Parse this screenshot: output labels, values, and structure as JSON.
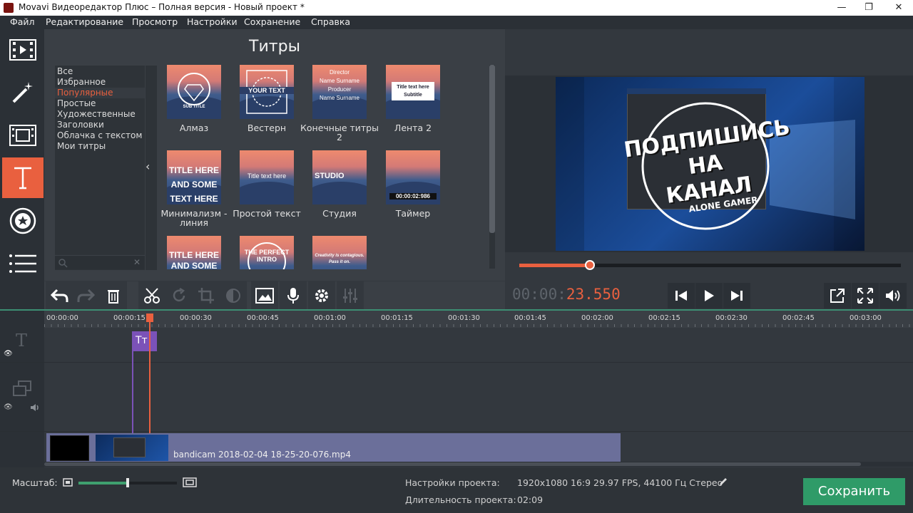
{
  "window": {
    "title": "Movavi Видеоредактор Плюс – Полная версия - Новый проект *",
    "minimize": "—",
    "maximize": "❐",
    "close": "✕"
  },
  "menu": [
    "Файл",
    "Редактирование",
    "Просмотр",
    "Настройки",
    "Сохранение",
    "Справка"
  ],
  "nav": [
    "film-import-icon",
    "magic-wand-icon",
    "filters-icon",
    "titles-icon",
    "stickers-icon",
    "menu-icon"
  ],
  "titles_panel": {
    "heading": "Титры",
    "categories": [
      "Все",
      "Избранное",
      "Популярные",
      "Простые",
      "Художественные",
      "Заголовки",
      "Облачка с текстом",
      "Мои титры"
    ],
    "selected_category": "Популярные",
    "tiles": [
      {
        "label": "Алмаз",
        "text": "SUB TITLE"
      },
      {
        "label": "Вестерн",
        "text": "YOUR TEXT"
      },
      {
        "label": "Конечные титры 2",
        "text": "Director\nName Surname\nProducer\nName Surname"
      },
      {
        "label": "Лента 2",
        "text": "Title text here\nSubtitle"
      },
      {
        "label": "Минимализм - линия",
        "text": "TITLE HERE\nAND SOME TEXT HERE"
      },
      {
        "label": "Простой текст",
        "text": "Title text here"
      },
      {
        "label": "Студия",
        "text": "STUDIO"
      },
      {
        "label": "Таймер",
        "text": "00:00:02:986"
      },
      {
        "label": "",
        "text": "TITLE HERE\nAND SOME TEXT HERE"
      },
      {
        "label": "",
        "text": "THE PERFECT INTRO"
      },
      {
        "label": "",
        "text": "Creativity is contagious.\nPass it on."
      }
    ]
  },
  "preview": {
    "overlay_line1": "ПОДПИШИСЬ",
    "overlay_line2": "НА",
    "overlay_line3": "КАНАЛ",
    "overlay_sub": "ALONE GAMER",
    "progress": 0.185
  },
  "timecode": {
    "dim": "00:00:",
    "hot": "23.550"
  },
  "ruler": [
    "00:00:00",
    "00:00:15",
    "00:00:30",
    "00:00:45",
    "00:01:00",
    "00:01:15",
    "00:01:30",
    "00:01:45",
    "00:02:00",
    "00:02:15",
    "00:02:30",
    "00:02:45",
    "00:03:00"
  ],
  "timeline": {
    "title_clip": "Тт",
    "video_clip_name": "bandicam 2018-02-04 18-25-20-076.mp4"
  },
  "bottom": {
    "scale_label": "Масштаб:",
    "settings_label": "Настройки проекта:",
    "settings_value": "1920x1080 16:9 29.97 FPS, 44100 Гц Стерео",
    "duration_label": "Длительность проекта:",
    "duration_value": "02:09",
    "save": "Сохранить",
    "zoom_level": 0.5
  },
  "colors": {
    "accent": "#e9603f",
    "save": "#2f9b68",
    "title_clip": "#7b52b8"
  }
}
